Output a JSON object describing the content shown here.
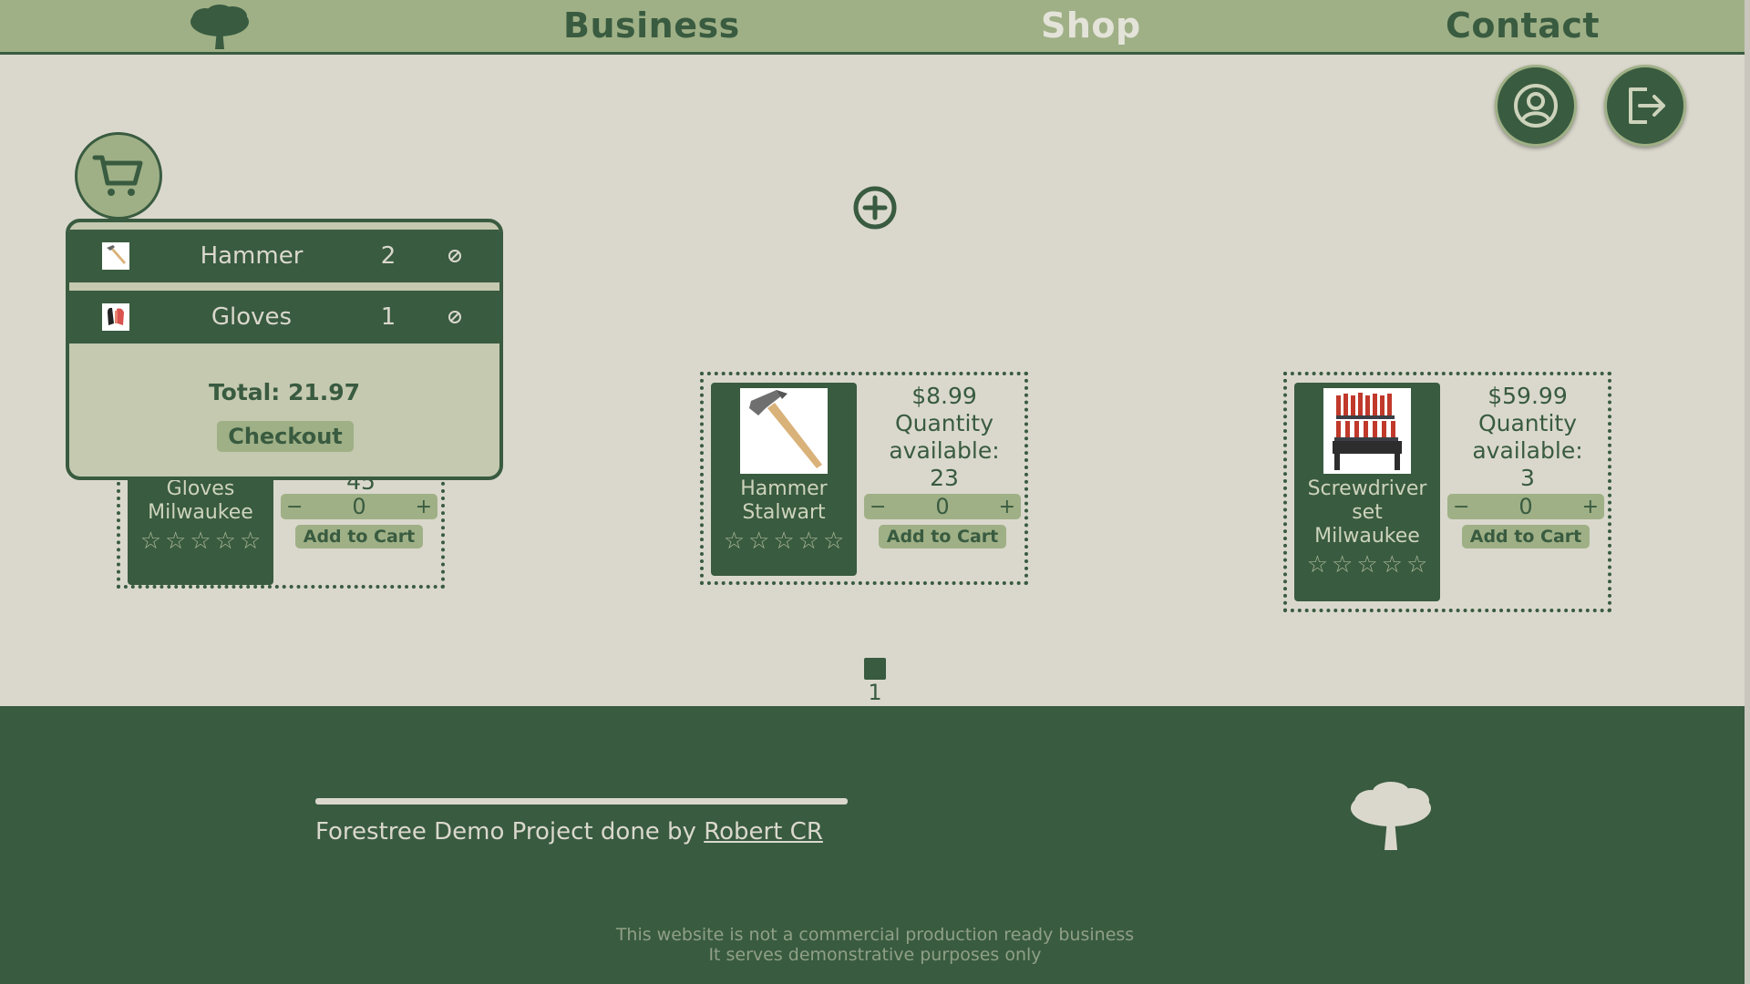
{
  "colors": {
    "primary": "#395b40",
    "accent": "#9fb086",
    "background": "#dad8cc",
    "popup": "#c4c9af"
  },
  "header": {
    "logo_icon": "tree-icon",
    "nav": {
      "business": "Business",
      "shop": "Shop",
      "contact": "Contact"
    },
    "active": "Shop"
  },
  "user_actions": {
    "profile_icon": "user-circle-icon",
    "logout_icon": "logout-icon"
  },
  "cart": {
    "icon": "cart-icon",
    "items": [
      {
        "name": "Hammer",
        "qty": "2",
        "thumb": "hammer-thumb",
        "remove_icon": "remove-icon"
      },
      {
        "name": "Gloves",
        "qty": "1",
        "thumb": "gloves-thumb",
        "remove_icon": "remove-icon"
      }
    ],
    "total": "Total: 21.97",
    "checkout": "Checkout"
  },
  "add_product_icon": "plus-circle-icon",
  "products": [
    {
      "name": "Gloves Milwaukee",
      "price": "",
      "quantity_label": "",
      "quantity": "45",
      "qty_value": "0",
      "minus": "−",
      "plus": "+",
      "add_label": "Add to Cart",
      "stars": [
        "☆",
        "☆",
        "☆",
        "☆",
        "☆"
      ]
    },
    {
      "name": "Hammer Stalwart",
      "price": "$8.99",
      "quantity_label": "Quantity available:",
      "quantity": "23",
      "qty_value": "0",
      "minus": "−",
      "plus": "+",
      "add_label": "Add to Cart",
      "stars": [
        "☆",
        "☆",
        "☆",
        "☆",
        "☆"
      ]
    },
    {
      "name": "Screwdriver set Milwaukee",
      "price": "$59.99",
      "quantity_label": "Quantity available:",
      "quantity": "3",
      "qty_value": "0",
      "minus": "−",
      "plus": "+",
      "add_label": "Add to Cart",
      "stars": [
        "☆",
        "☆",
        "☆",
        "☆",
        "☆"
      ]
    }
  ],
  "pagination": {
    "current": "1"
  },
  "footer": {
    "credit_prefix": "Forestree Demo Project done by ",
    "credit_link": "Robert CR",
    "tree_icon": "tree-icon",
    "disclaimer_line1": "This website is not a commercial production ready business",
    "disclaimer_line2": "It serves demonstrative purposes only"
  }
}
